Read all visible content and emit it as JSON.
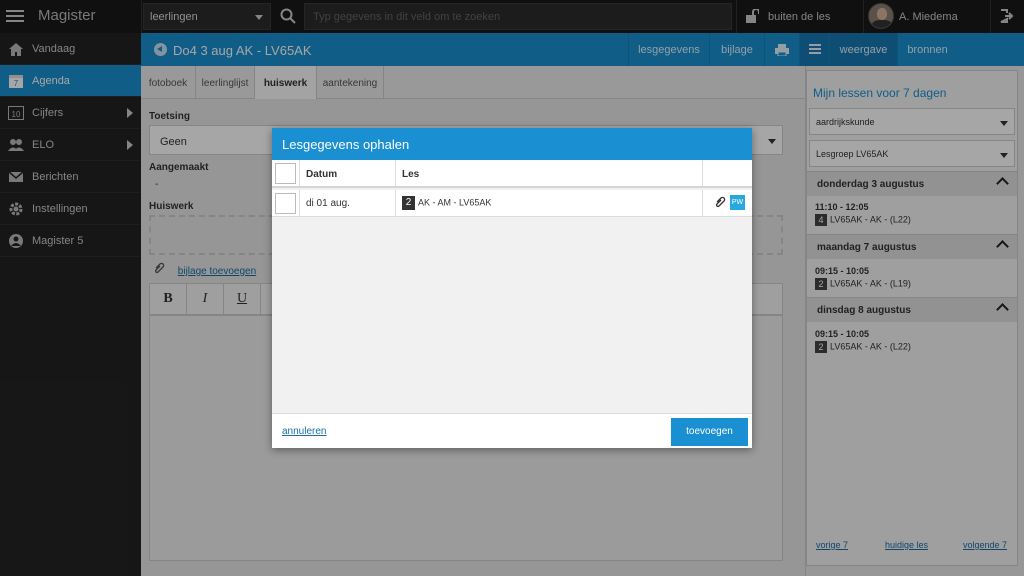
{
  "app": {
    "brand": "Magister"
  },
  "topbar": {
    "context_select": "leerlingen",
    "search_placeholder": "Typ gegevens in dit veld om te zoeken",
    "status": "buiten de les",
    "user": "A. Miedema"
  },
  "sidebar": {
    "items": [
      {
        "label": "Vandaag",
        "icon": "home-icon"
      },
      {
        "label": "Agenda",
        "icon": "calendar-icon",
        "active": true
      },
      {
        "label": "Cijfers",
        "icon": "grades-icon",
        "has_submenu": true
      },
      {
        "label": "ELO",
        "icon": "people-icon",
        "has_submenu": true
      },
      {
        "label": "Berichten",
        "icon": "envelope-icon"
      },
      {
        "label": "Instellingen",
        "icon": "gear-icon"
      },
      {
        "label": "Magister 5",
        "icon": "magister-icon"
      }
    ]
  },
  "header": {
    "title": "Do4 3 aug AK - LV65AK",
    "buttons": [
      "lesgegevens",
      "bijlage",
      "weergave",
      "bronnen"
    ]
  },
  "tabs": [
    "fotoboek",
    "leerlinglijst",
    "huiswerk",
    "aantekening"
  ],
  "form": {
    "toetsing_label": "Toetsing",
    "toetsing_value": "Geen",
    "aangemaakt_label": "Aangemaakt",
    "aangemaakt_value": "-",
    "huiswerk_label": "Huiswerk",
    "bijlage_link": "bijlage toevoegen",
    "editor_buttons": [
      "B",
      "I",
      "U"
    ]
  },
  "rightpanel": {
    "title": "Mijn lessen voor 7 dagen",
    "subject_select": "aardrijkskunde",
    "group_select": "Lesgroep LV65AK",
    "days": [
      {
        "day": "donderdag 3 augustus",
        "time": "11:10 - 12:05",
        "hour": "4",
        "lesson": "LV65AK - AK - (L22)"
      },
      {
        "day": "maandag 7 augustus",
        "time": "09:15 - 10:05",
        "hour": "2",
        "lesson": "LV65AK - AK - (L19)"
      },
      {
        "day": "dinsdag 8 augustus",
        "time": "09:15 - 10:05",
        "hour": "2",
        "lesson": "LV65AK - AK - (L22)"
      }
    ],
    "footer": {
      "prev": "vorige 7",
      "current": "huidige les",
      "next": "volgende 7"
    }
  },
  "modal": {
    "title": "Lesgegevens ophalen",
    "columns": {
      "datum": "Datum",
      "les": "Les"
    },
    "rows": [
      {
        "datum": "di 01 aug.",
        "hour": "2",
        "les": "AK - AM - LV65AK",
        "badge": "PW"
      }
    ],
    "cancel": "annuleren",
    "confirm": "toevoegen"
  },
  "colors": {
    "accent": "#1a8fd1",
    "topbar": "#1a1a1a",
    "sidebar": "#232323"
  }
}
